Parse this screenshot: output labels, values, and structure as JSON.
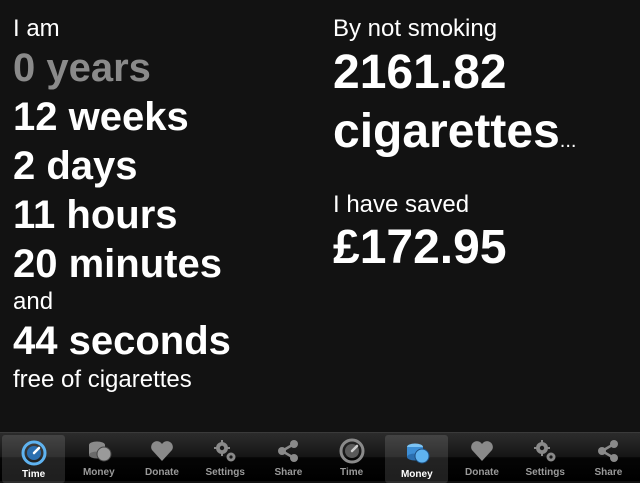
{
  "time_panel": {
    "intro": "I am",
    "years": "0 years",
    "weeks": "12 weeks",
    "days": "2 days",
    "hours": "11 hours",
    "minutes": "20 minutes",
    "and": "and",
    "seconds": "44 seconds",
    "outro": "free of cigarettes"
  },
  "money_panel": {
    "intro": "By not smoking",
    "cigarettes_count": "2161.82",
    "cigarettes_word": "cigarettes",
    "ellipsis": "...",
    "saved_label": "I have saved",
    "saved_amount": "£172.95"
  },
  "tabbar_left": {
    "tabs": [
      {
        "label": "Time",
        "icon": "clock-icon",
        "selected": true
      },
      {
        "label": "Money",
        "icon": "coins-icon",
        "selected": false
      },
      {
        "label": "Donate",
        "icon": "heart-icon",
        "selected": false
      },
      {
        "label": "Settings",
        "icon": "gears-icon",
        "selected": false
      },
      {
        "label": "Share",
        "icon": "share-icon",
        "selected": false
      }
    ]
  },
  "tabbar_right": {
    "tabs": [
      {
        "label": "Time",
        "icon": "clock-icon",
        "selected": false
      },
      {
        "label": "Money",
        "icon": "coins-icon",
        "selected": true
      },
      {
        "label": "Donate",
        "icon": "heart-icon",
        "selected": false
      },
      {
        "label": "Settings",
        "icon": "gears-icon",
        "selected": false
      },
      {
        "label": "Share",
        "icon": "share-icon",
        "selected": false
      }
    ]
  },
  "colors": {
    "background": "#121212",
    "text": "#ffffff",
    "muted_text": "#8a8a8a",
    "tab_label": "#9a9a9a",
    "accent_blue": "#4aa3e8"
  }
}
